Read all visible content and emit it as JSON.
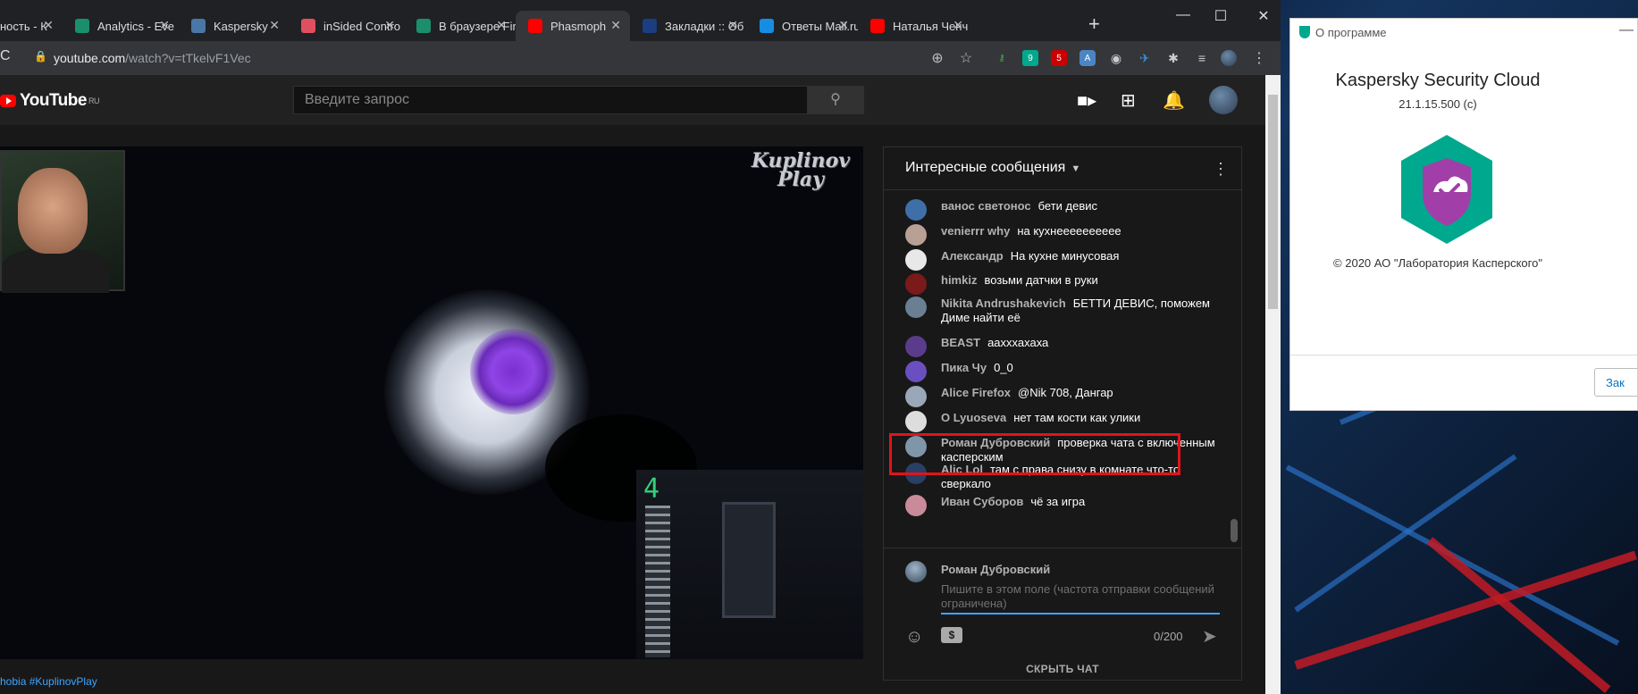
{
  "browser": {
    "tabs": [
      {
        "label": "ность - К",
        "fav": "generic-icon",
        "color": "#5f6368"
      },
      {
        "label": "Analytics - Eve",
        "fav": "k-icon",
        "color": "#1b8f6b"
      },
      {
        "label": "Kaspersky",
        "fav": "vk-icon",
        "color": "#4a76a8"
      },
      {
        "label": "inSided Contro",
        "fav": "insided-icon",
        "color": "#e04f5f"
      },
      {
        "label": "В браузере Fir",
        "fav": "k-icon",
        "color": "#1b8f6b"
      },
      {
        "label": "Phasmoph",
        "fav": "youtube-icon",
        "color": "#ff0000"
      },
      {
        "label": "Закладки :: Об",
        "fav": "ru-icon",
        "color": "#1a3e80"
      },
      {
        "label": "Ответы Mail.ru",
        "fav": "question-icon",
        "color": "#168de2"
      },
      {
        "label": "Наталья Ченч",
        "fav": "youtube-icon",
        "color": "#ff0000"
      }
    ],
    "url_domain": "youtube.com",
    "url_path": "/watch?v=tTkelvF1Vec",
    "abp_count": "5",
    "ext_badge": "9"
  },
  "youtube": {
    "logo": "YouTube",
    "region": "RU",
    "search_placeholder": "Введите запрос",
    "hashtags": "hobia #KuplinovPlay"
  },
  "player": {
    "watermark_line1": "Kuplinov",
    "watermark_line2": "Play",
    "counter": "4"
  },
  "chat": {
    "title": "Интересные сообщения",
    "messages": [
      {
        "author": "ванос светонос",
        "text": "бети девис",
        "av": "#3f6fa8"
      },
      {
        "author": "venierrr why",
        "text": "на кухнееееееееее",
        "av": "#b8a095"
      },
      {
        "author": "Александр",
        "text": "На кухне минусовая",
        "av": "#e8e8e8"
      },
      {
        "author": "himkiz",
        "text": "возьми датчки в руки",
        "av": "#7a1a1a"
      },
      {
        "author": "Nikita Andrushakevich",
        "text": "БЕТТИ ДЕВИС, поможем Диме найти её",
        "av": "#6a7f92"
      },
      {
        "author": "BEAST",
        "text": "аахххахаха",
        "av": "#5b3c8c"
      },
      {
        "author": "Пика Чу",
        "text": "0_0",
        "av": "#6a4fc0"
      },
      {
        "author": "Alice Firefox",
        "text": "@Nik 708, Дангар",
        "av": "#9aa7b8"
      },
      {
        "author": "О Lyuoseva",
        "text": "нет там кости как улики",
        "av": "#dddddd"
      },
      {
        "author": "Роман Дубровский",
        "text": "проверка чата с включенным касперским",
        "av": "#7f95a8"
      },
      {
        "author": "Alic Lol",
        "text": "там с права снизу в комнате что-то сверкало",
        "av": "#2a3f66"
      },
      {
        "author": "Иван Суборов",
        "text": "чё за игра",
        "av": "#c98a9a"
      }
    ],
    "compose_author": "Роман Дубровский",
    "compose_placeholder": "Пишите в этом поле (частота отправки сообщений ограничена)",
    "counter": "0/200",
    "hide_label": "СКРЫТЬ ЧАТ",
    "highlight_color": "#e0141a"
  },
  "kaspersky": {
    "window_title": "О программе",
    "product_name": "Kaspersky Security Cloud",
    "version": "21.1.15.500 (c)",
    "copyright": "© 2020 АО \"Лаборатория Касперского\"",
    "close_button": "Зак",
    "brand_color": "#00a88e"
  }
}
